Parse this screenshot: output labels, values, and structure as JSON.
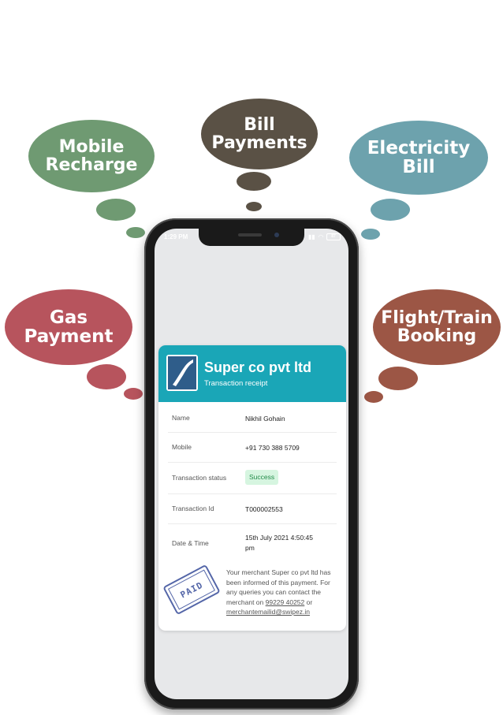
{
  "bubbles": {
    "bill": [
      "Bill",
      "Payments"
    ],
    "mobile": [
      "Mobile",
      "Recharge"
    ],
    "electricity": [
      "Electricity",
      "Bill"
    ],
    "gas": [
      "Gas",
      "Payment"
    ],
    "flight": [
      "Flight/Train",
      "Booking"
    ]
  },
  "status_bar": {
    "time": "1:29 PM",
    "battery": "87"
  },
  "receipt": {
    "company": "Super co pvt ltd",
    "subtitle": "Transaction receipt",
    "rows": [
      {
        "label": "Name",
        "value": "Nikhil Gohain"
      },
      {
        "label": "Mobile",
        "value": "+91 730 388 5709"
      },
      {
        "label": "Transaction status",
        "value": "Success"
      },
      {
        "label": "Transaction Id",
        "value": "T000002553"
      },
      {
        "label": "Date & Time",
        "value": "15th July 2021 4:50:45 pm"
      }
    ],
    "note": {
      "text": "Your merchant Super co pvt ltd has been informed of this payment. For any queries you can contact the merchant on",
      "phone": "99229 40252",
      "or": "or",
      "email": "merchantemailid@swipez.in"
    },
    "stamp": "PAID"
  },
  "colors": {
    "bill": "#5a5145",
    "mobile": "#6f9a72",
    "electricity": "#6da2ad",
    "gas": "#b7545d",
    "flight": "#9c5645",
    "receipt_header": "#1aa6b7",
    "success_badge": "#d6f5e0"
  }
}
